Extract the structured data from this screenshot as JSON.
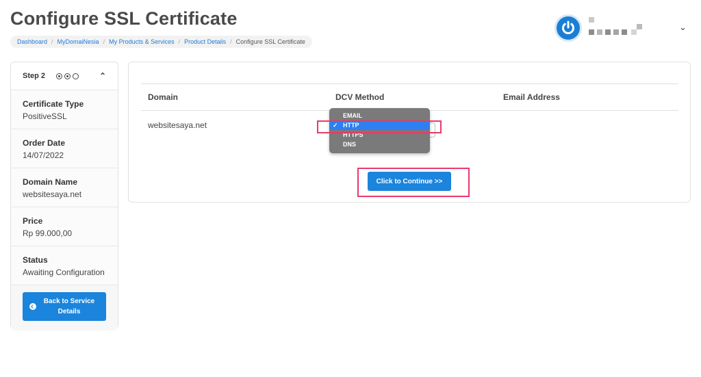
{
  "page": {
    "title": "Configure SSL Certificate"
  },
  "breadcrumb": {
    "items": [
      "Dashboard",
      "MyDomaiNesia",
      "My Products & Services",
      "Product Details"
    ],
    "current": "Configure SSL Certificate",
    "separator": "/"
  },
  "user": {
    "avatar_icon": "power-icon",
    "menu_caret": "⌄"
  },
  "sidebar": {
    "step_label": "Step 2",
    "collapse_caret": "⌃",
    "info": [
      {
        "label": "Certificate Type",
        "value": "PositiveSSL"
      },
      {
        "label": "Order Date",
        "value": "14/07/2022"
      },
      {
        "label": "Domain Name",
        "value": "websitesaya.net"
      },
      {
        "label": "Price",
        "value": "Rp 99.000,00"
      },
      {
        "label": "Status",
        "value": "Awaiting Configuration"
      }
    ],
    "back_button": {
      "line1": "Back to Service",
      "line2": "Details"
    }
  },
  "table": {
    "headers": {
      "domain": "Domain",
      "dcv": "DCV Method",
      "email": "Email Address"
    },
    "rows": [
      {
        "domain": "websitesaya.net",
        "dcv": "HTTP",
        "email": ""
      }
    ]
  },
  "dcv_dropdown": {
    "options": [
      "EMAIL",
      "HTTP",
      "HTTPS",
      "DNS"
    ],
    "selected": "HTTP",
    "check": "✓",
    "select_caret": "⌄"
  },
  "continue_button": {
    "label": "Click to Continue >>"
  },
  "colors": {
    "accent": "#1b84dc",
    "highlight": "#e8396b",
    "dropdown_bg": "#7a7a7a",
    "selected_option": "#2f7ff0"
  }
}
